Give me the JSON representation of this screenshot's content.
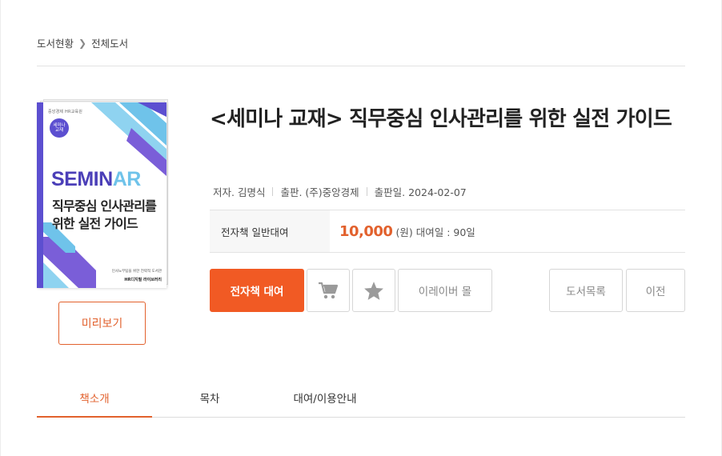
{
  "breadcrumb": {
    "home": "도서현황",
    "current": "전체도서"
  },
  "cover": {
    "logo_text": "중앙경제 HR교육원",
    "badge_line1": "세미나",
    "badge_line2": "교재",
    "seminar_main": "SEMIN",
    "seminar_accent": "AR",
    "title_line1": "직무중심 인사관리를",
    "title_line2": "위한 실전 가이드",
    "footer_line1": "인사노무팀을 위한 전략적 도서관",
    "footer_line2": "HR디지털 라이브러리"
  },
  "preview_label": "미리보기",
  "book": {
    "title": "<세미나 교재> 직무중심 인사관리를 위한 실전 가이드",
    "author": "저자. 김명식",
    "publisher": "출판. (주)중앙경제",
    "pub_date": "출판일. 2024-02-07"
  },
  "price": {
    "label": "전자책 일반대여",
    "amount": "10,000",
    "unit": "(원)",
    "period": "대여일 : 90일"
  },
  "actions": {
    "rent": "전자책 대여",
    "mall": "이레이버 몰",
    "list": "도서목록",
    "prev": "이전"
  },
  "icons": {
    "cart": "cart-icon",
    "favorite": "star-icon"
  },
  "colors": {
    "accent": "#f15a24",
    "accent_text": "#e2612d",
    "cover_purple": "#5c4fd0",
    "cover_blue": "#6fc3ea"
  },
  "tabs": [
    {
      "label": "책소개",
      "active": true
    },
    {
      "label": "목차",
      "active": false
    },
    {
      "label": "대여/이용안내",
      "active": false
    }
  ]
}
